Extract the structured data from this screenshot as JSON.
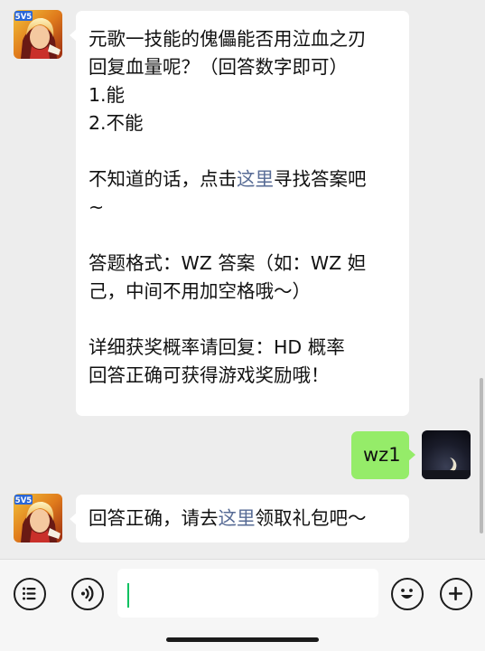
{
  "messages": [
    {
      "side": "in",
      "lines": [
        [
          "元歌一技能的傀儡能否用泣血之刃"
        ],
        [
          "回复血量呢？（回答数字即可）"
        ],
        [
          "1.能"
        ],
        [
          "2.不能"
        ],
        [
          ""
        ],
        [
          "不知道的话，点击",
          {
            "link": "这里"
          },
          "寻找答案吧"
        ],
        [
          "~"
        ],
        [
          ""
        ],
        [
          "答题格式：WZ 答案（如：WZ 妲"
        ],
        [
          "己，中间不用加空格哦～）"
        ],
        [
          ""
        ],
        [
          "详细获奖概率请回复：HD 概率"
        ],
        [
          "回答正确可获得游戏奖励哦！"
        ]
      ]
    },
    {
      "side": "out",
      "text": "wz1"
    },
    {
      "side": "in",
      "lines": [
        [
          "回答正确，请去",
          {
            "link": "这里"
          },
          "领取礼包吧～"
        ]
      ]
    }
  ],
  "avatars": {
    "game_badge": "5V5"
  },
  "input_bar": {
    "icons": [
      "menu-icon",
      "voice-icon",
      "emoji-icon",
      "plus-icon"
    ],
    "text_value": ""
  },
  "colors": {
    "background": "#ededed",
    "bubble_in": "#ffffff",
    "bubble_out": "#95ec69",
    "link": "#576b95",
    "caret": "#07c160"
  }
}
